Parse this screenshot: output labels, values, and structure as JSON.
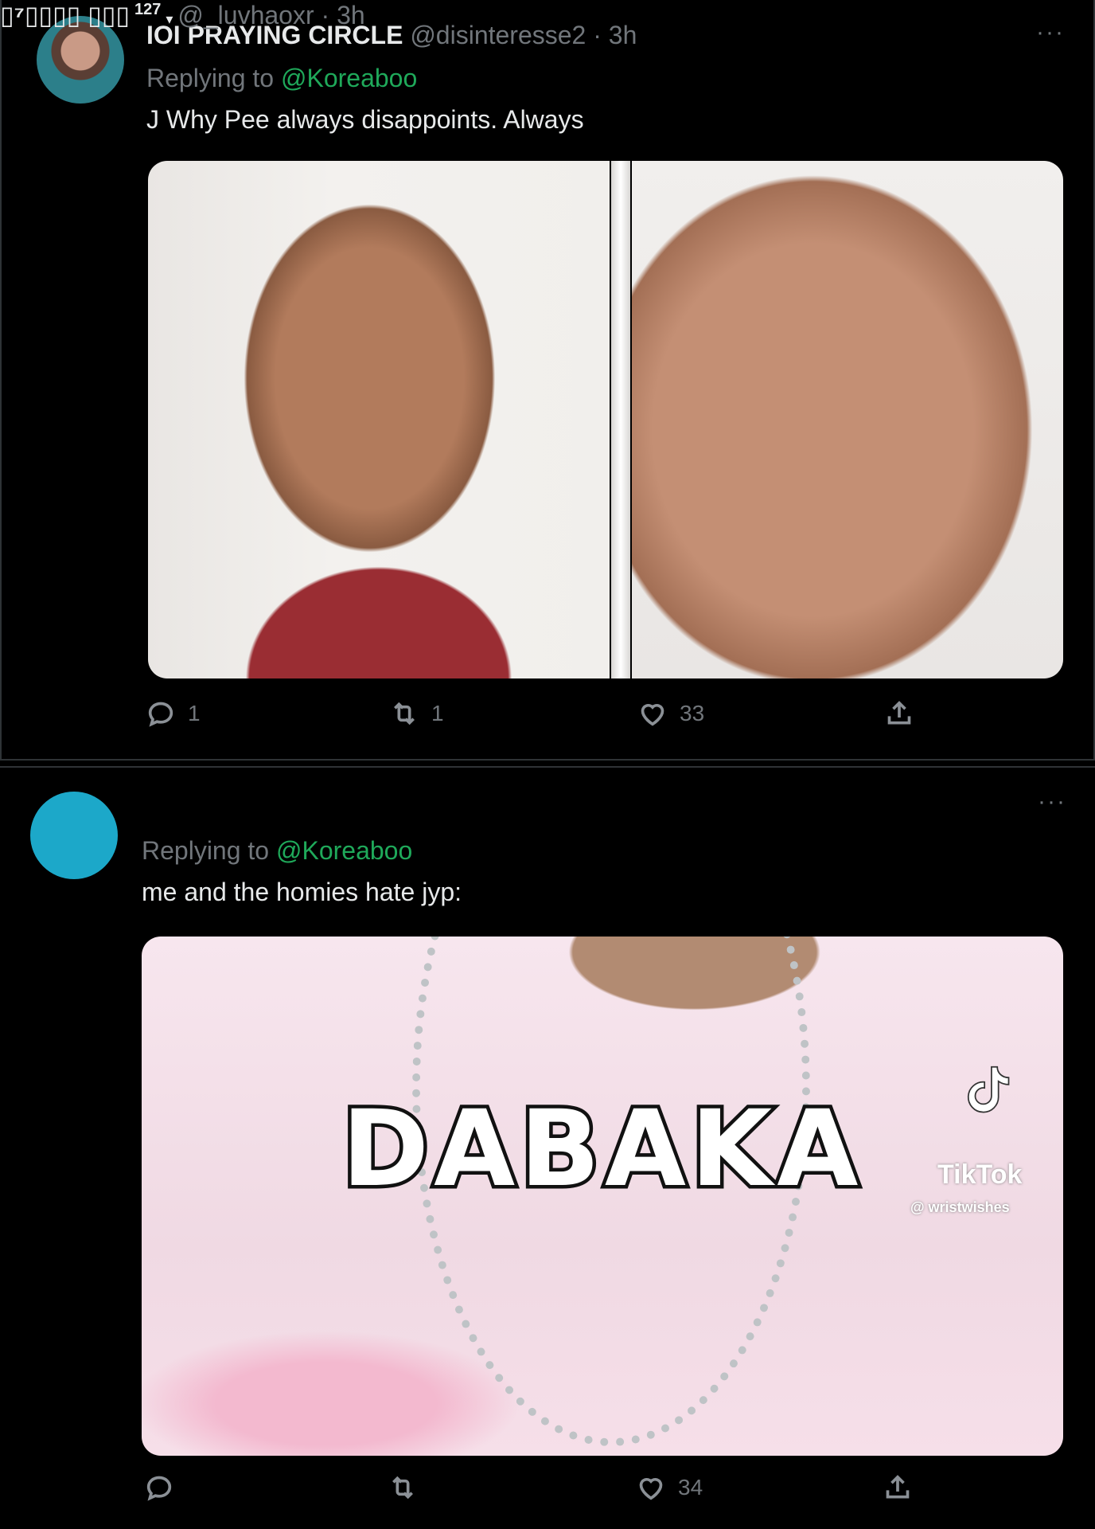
{
  "tweets": [
    {
      "display_name": "IOI PRAYING CIRCLE",
      "handle": "@disinteresse2",
      "sep": "·",
      "time": "3h",
      "more": "···",
      "replying_prefix": "Replying to",
      "replying_to": "@Koreaboo",
      "text": "J Why Pee always disappoints. Always",
      "media_type": "two-photo collage",
      "actions": {
        "reply_count": "1",
        "retweet_count": "1",
        "like_count": "33",
        "share_count": ""
      }
    },
    {
      "display_name": "▯⁷▯▯▯▯ ▯▯▯",
      "verified_mark": "127",
      "dropdown_icon": "▾",
      "handle": "@_luvhaoxr",
      "sep": "·",
      "time": "3h",
      "more": "···",
      "replying_prefix": "Replying to",
      "replying_to": "@Koreaboo",
      "text": "me and the homies hate jyp:",
      "media_caption": "DABAKA",
      "watermark": "TikTok",
      "watermark_user": "@ wristwishes",
      "actions": {
        "reply_count": "",
        "retweet_count": "",
        "like_count": "34",
        "share_count": ""
      }
    }
  ],
  "icons": [
    "reply-icon",
    "retweet-icon",
    "like-icon",
    "share-icon",
    "tiktok-icon"
  ],
  "colors": {
    "background": "#000000",
    "mention": "#1fa95a",
    "muted": "#71767b",
    "text": "#e7e9ea",
    "avatar2": "#1ca8c9"
  }
}
